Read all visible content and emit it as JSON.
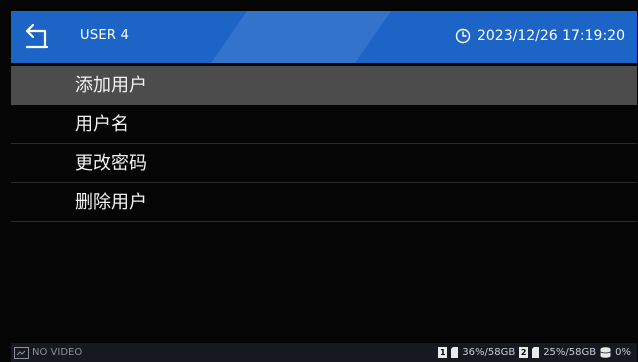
{
  "header": {
    "title": "USER 4",
    "datetime": "2023/12/26 17:19:20",
    "accent": "#1c64c6"
  },
  "menu": {
    "items": [
      {
        "label": "添加用户",
        "selected": true
      },
      {
        "label": "用户名",
        "selected": false
      },
      {
        "label": "更改密码",
        "selected": false
      },
      {
        "label": "删除用户",
        "selected": false
      }
    ]
  },
  "footer": {
    "video_status": "NO VIDEO",
    "disk1_index": "1",
    "disk1_usage": "36%/58GB",
    "disk2_index": "2",
    "disk2_usage": "25%/58GB",
    "storage_usage": "0%"
  }
}
